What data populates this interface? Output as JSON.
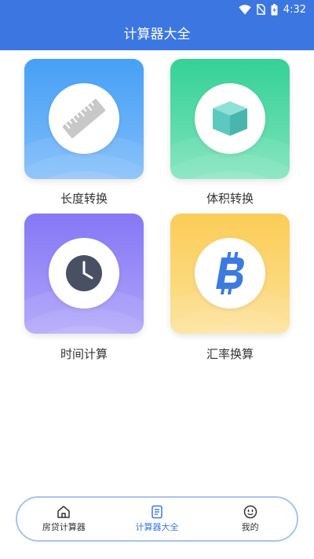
{
  "status_bar": {
    "time": "4:32",
    "icons": [
      "wifi-icon",
      "no-sim-icon",
      "battery-charging-icon"
    ]
  },
  "header": {
    "title": "计算器大全"
  },
  "tools": [
    {
      "label": "长度转换",
      "icon": "ruler-icon",
      "color_top": "#4aa0f5",
      "color_bottom": "#8fc4fb"
    },
    {
      "label": "体积转换",
      "icon": "cube-icon",
      "color_top": "#38d399",
      "color_bottom": "#86e6c0"
    },
    {
      "label": "时间计算",
      "icon": "clock-icon",
      "color_top": "#8b7cf6",
      "color_bottom": "#b2a8fa"
    },
    {
      "label": "汇率换算",
      "icon": "bitcoin-icon",
      "color_top": "#fbcf5b",
      "color_bottom": "#fde39b"
    }
  ],
  "tab_bar": {
    "items": [
      {
        "label": "房贷计算器",
        "icon": "home-icon",
        "active": false
      },
      {
        "label": "计算器大全",
        "icon": "list-icon",
        "active": true
      },
      {
        "label": "我的",
        "icon": "smile-icon",
        "active": false
      }
    ],
    "active_color": "#3b76e1"
  }
}
